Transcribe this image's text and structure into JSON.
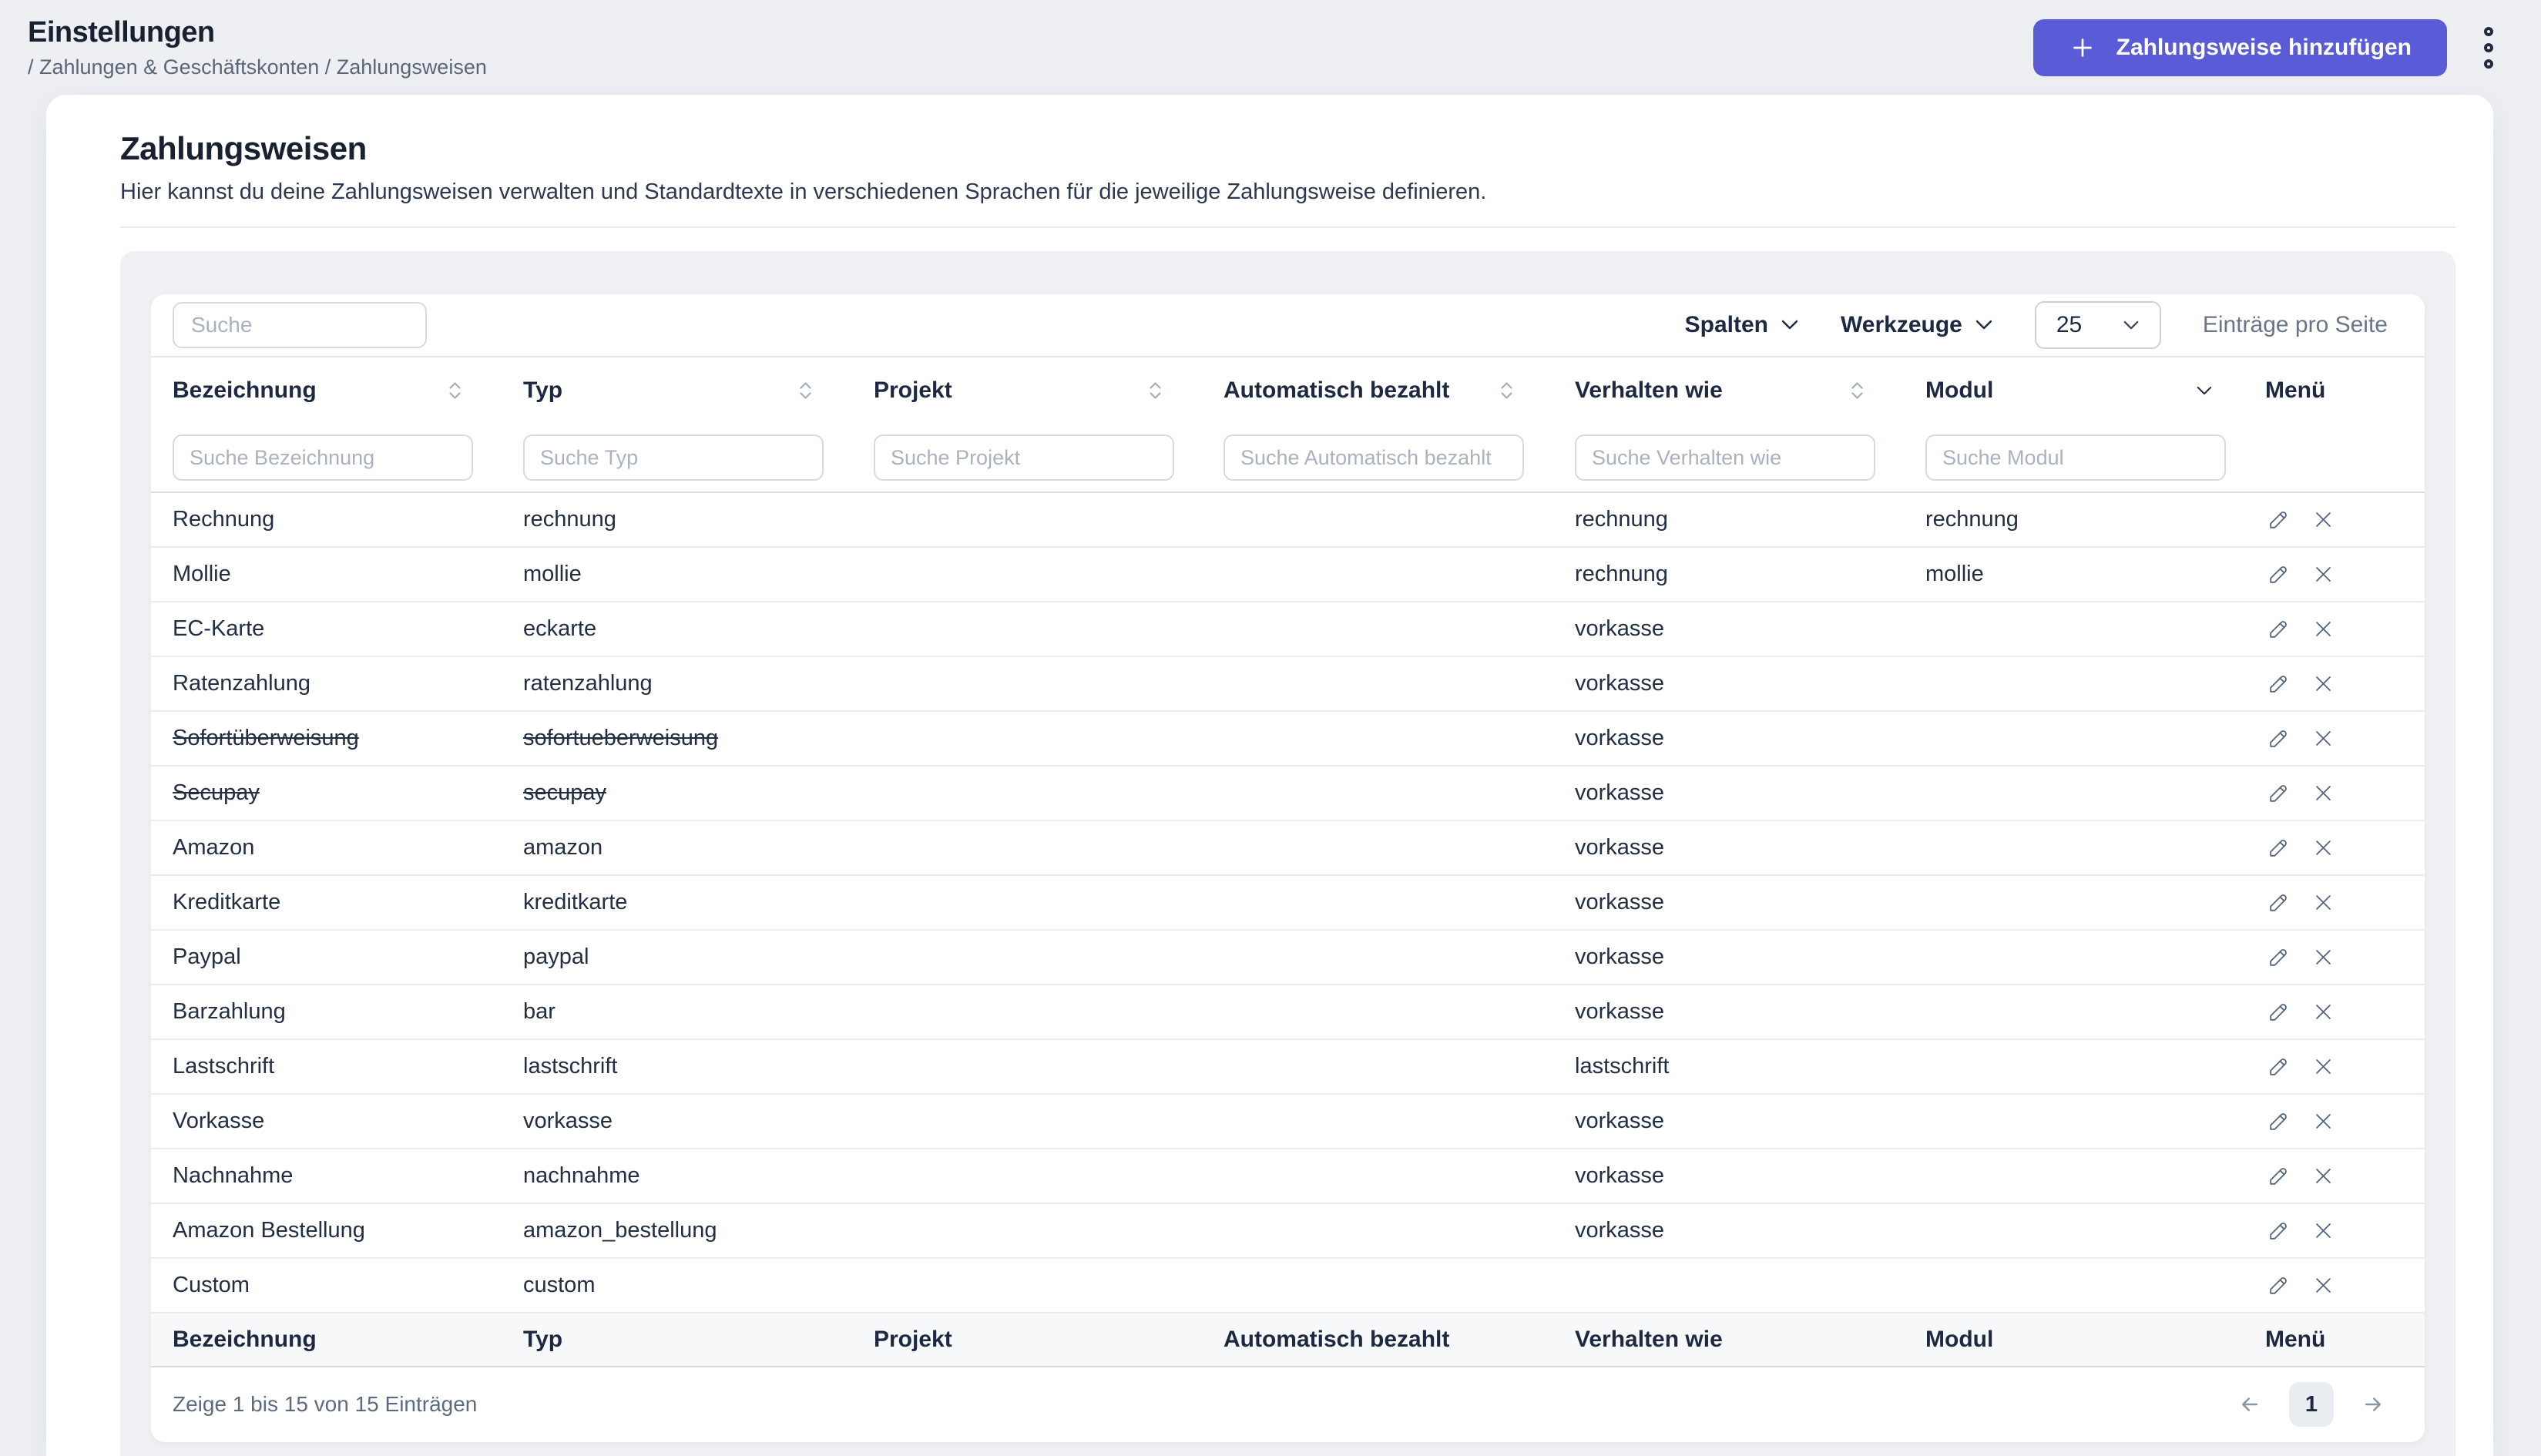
{
  "header": {
    "title": "Einstellungen",
    "breadcrumb": "/ Zahlungen & Geschäftskonten / Zahlungsweisen",
    "add_button_label": "Zahlungsweise hinzufügen"
  },
  "page": {
    "title": "Zahlungsweisen",
    "subtitle": "Hier kannst du deine Zahlungsweisen verwalten und Standardtexte in verschiedenen Sprachen für die jeweilige Zahlungsweise definieren."
  },
  "toolbar": {
    "search_placeholder": "Suche",
    "columns_label": "Spalten",
    "tools_label": "Werkzeuge",
    "page_size": "25",
    "page_size_label": "Einträge pro Seite"
  },
  "table": {
    "columns": [
      "Bezeichnung",
      "Typ",
      "Projekt",
      "Automatisch bezahlt",
      "Verhalten wie",
      "Modul",
      "Menü"
    ],
    "filter_placeholders": [
      "Suche Bezeichnung",
      "Suche Typ",
      "Suche Projekt",
      "Suche Automatisch bezahlt",
      "Suche Verhalten wie",
      "Suche Modul"
    ],
    "rows": [
      {
        "bezeichnung": "Rechnung",
        "typ": "rechnung",
        "projekt": "",
        "automatisch_bezahlt": "",
        "verhalten_wie": "rechnung",
        "modul": "rechnung",
        "deleted": false
      },
      {
        "bezeichnung": "Mollie",
        "typ": "mollie",
        "projekt": "",
        "automatisch_bezahlt": "",
        "verhalten_wie": "rechnung",
        "modul": "mollie",
        "deleted": false
      },
      {
        "bezeichnung": "EC-Karte",
        "typ": "eckarte",
        "projekt": "",
        "automatisch_bezahlt": "",
        "verhalten_wie": "vorkasse",
        "modul": "",
        "deleted": false
      },
      {
        "bezeichnung": "Ratenzahlung",
        "typ": "ratenzahlung",
        "projekt": "",
        "automatisch_bezahlt": "",
        "verhalten_wie": "vorkasse",
        "modul": "",
        "deleted": false
      },
      {
        "bezeichnung": "Sofortüberweisung",
        "typ": "sofortueberweisung",
        "projekt": "",
        "automatisch_bezahlt": "",
        "verhalten_wie": "vorkasse",
        "modul": "",
        "deleted": true
      },
      {
        "bezeichnung": "Secupay",
        "typ": "secupay",
        "projekt": "",
        "automatisch_bezahlt": "",
        "verhalten_wie": "vorkasse",
        "modul": "",
        "deleted": true
      },
      {
        "bezeichnung": "Amazon",
        "typ": "amazon",
        "projekt": "",
        "automatisch_bezahlt": "",
        "verhalten_wie": "vorkasse",
        "modul": "",
        "deleted": false
      },
      {
        "bezeichnung": "Kreditkarte",
        "typ": "kreditkarte",
        "projekt": "",
        "automatisch_bezahlt": "",
        "verhalten_wie": "vorkasse",
        "modul": "",
        "deleted": false
      },
      {
        "bezeichnung": "Paypal",
        "typ": "paypal",
        "projekt": "",
        "automatisch_bezahlt": "",
        "verhalten_wie": "vorkasse",
        "modul": "",
        "deleted": false
      },
      {
        "bezeichnung": "Barzahlung",
        "typ": "bar",
        "projekt": "",
        "automatisch_bezahlt": "",
        "verhalten_wie": "vorkasse",
        "modul": "",
        "deleted": false
      },
      {
        "bezeichnung": "Lastschrift",
        "typ": "lastschrift",
        "projekt": "",
        "automatisch_bezahlt": "",
        "verhalten_wie": "lastschrift",
        "modul": "",
        "deleted": false
      },
      {
        "bezeichnung": "Vorkasse",
        "typ": "vorkasse",
        "projekt": "",
        "automatisch_bezahlt": "",
        "verhalten_wie": "vorkasse",
        "modul": "",
        "deleted": false
      },
      {
        "bezeichnung": "Nachnahme",
        "typ": "nachnahme",
        "projekt": "",
        "automatisch_bezahlt": "",
        "verhalten_wie": "vorkasse",
        "modul": "",
        "deleted": false
      },
      {
        "bezeichnung": "Amazon Bestellung",
        "typ": "amazon_bestellung",
        "projekt": "",
        "automatisch_bezahlt": "",
        "verhalten_wie": "vorkasse",
        "modul": "",
        "deleted": false
      },
      {
        "bezeichnung": "Custom",
        "typ": "custom",
        "projekt": "",
        "automatisch_bezahlt": "",
        "verhalten_wie": "",
        "modul": "",
        "deleted": false
      }
    ]
  },
  "footer": {
    "summary": "Zeige 1 bis 15 von 15 Einträgen",
    "current_page": "1"
  },
  "colors": {
    "accent": "#5a5bd7",
    "text_dark": "#1d2940",
    "text_muted": "#6a7687",
    "page_background": "#edeff3",
    "panel_background": "#eef0f4"
  },
  "icons": {
    "plus": "+",
    "kebab": "three hollow dots vertical",
    "chevron_down": "∨",
    "sort": "up+down chevrons",
    "edit": "pencil outline",
    "delete": "×",
    "prev": "←",
    "next": "→"
  }
}
